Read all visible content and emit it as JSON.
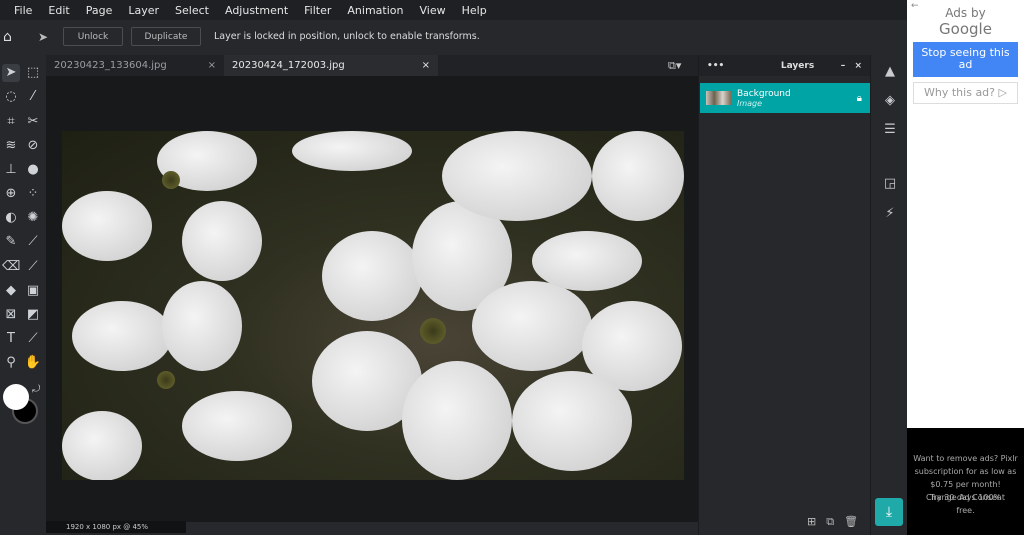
{
  "menu": [
    "File",
    "Edit",
    "Page",
    "Layer",
    "Select",
    "Adjustment",
    "Filter",
    "Animation",
    "View",
    "Help"
  ],
  "toolbar": {
    "unlock": "Unlock",
    "duplicate": "Duplicate",
    "message": "Layer is locked in position, unlock to enable transforms."
  },
  "tabs": [
    {
      "label": "20230423_133604.jpg",
      "close": "×"
    },
    {
      "label": "20230424_172003.jpg",
      "close": "×",
      "active": true
    }
  ],
  "status": "1920 x 1080 px @ 45%",
  "layers": {
    "title": "Layers",
    "more": "•••",
    "minimize": "–",
    "close": "×",
    "items": [
      {
        "name": "Background",
        "type": "Image",
        "locked": true
      }
    ]
  },
  "ad": {
    "back": "←",
    "ads_by": "Ads by",
    "google": "Google",
    "stop": "Stop seeing this ad",
    "why": "Why this ad? ▷",
    "remove_text": "Want to remove ads? Pixlr subscription for as low as $0.75 per month!",
    "trial": "Try 30 days 100% free.",
    "consent": "Change Ad Consent"
  },
  "colors": {
    "accent": "#00a4a4",
    "ad_button": "#4285f4",
    "foreground": "#ffffff",
    "background": "#000000"
  }
}
